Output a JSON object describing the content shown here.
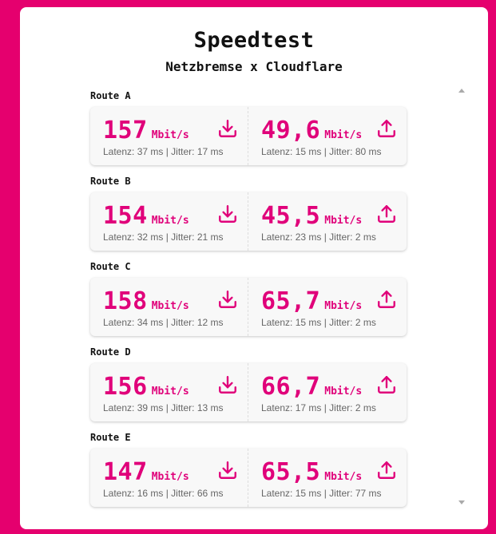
{
  "header": {
    "title": "Speedtest",
    "subtitle": "Netzbremse x Cloudflare"
  },
  "labels": {
    "latency_prefix": "Latenz: ",
    "jitter_prefix": " | Jitter: "
  },
  "icons": {
    "download": "download-icon",
    "upload": "upload-icon",
    "scroll_up": "triangle-up",
    "scroll_down": "triangle-down"
  },
  "colors": {
    "background": "#e5006e",
    "accent": "#e0007a",
    "card": "#ffffff",
    "result_box": "#f8f8f8",
    "muted_text": "#666666"
  },
  "routes": [
    {
      "label": "Route A",
      "download": {
        "value": "157",
        "unit": "Mbit/s",
        "latency": "37 ms",
        "jitter": "17 ms"
      },
      "upload": {
        "value": "49,6",
        "unit": "Mbit/s",
        "latency": "15 ms",
        "jitter": "80 ms"
      }
    },
    {
      "label": "Route B",
      "download": {
        "value": "154",
        "unit": "Mbit/s",
        "latency": "32 ms",
        "jitter": "21 ms"
      },
      "upload": {
        "value": "45,5",
        "unit": "Mbit/s",
        "latency": "23 ms",
        "jitter": "2 ms"
      }
    },
    {
      "label": "Route C",
      "download": {
        "value": "158",
        "unit": "Mbit/s",
        "latency": "34 ms",
        "jitter": "12 ms"
      },
      "upload": {
        "value": "65,7",
        "unit": "Mbit/s",
        "latency": "15 ms",
        "jitter": "2 ms"
      }
    },
    {
      "label": "Route D",
      "download": {
        "value": "156",
        "unit": "Mbit/s",
        "latency": "39 ms",
        "jitter": "13 ms"
      },
      "upload": {
        "value": "66,7",
        "unit": "Mbit/s",
        "latency": "17 ms",
        "jitter": "2 ms"
      }
    },
    {
      "label": "Route E",
      "download": {
        "value": "147",
        "unit": "Mbit/s",
        "latency": "16 ms",
        "jitter": "66 ms"
      },
      "upload": {
        "value": "65,5",
        "unit": "Mbit/s",
        "latency": "15 ms",
        "jitter": "77 ms"
      }
    }
  ]
}
